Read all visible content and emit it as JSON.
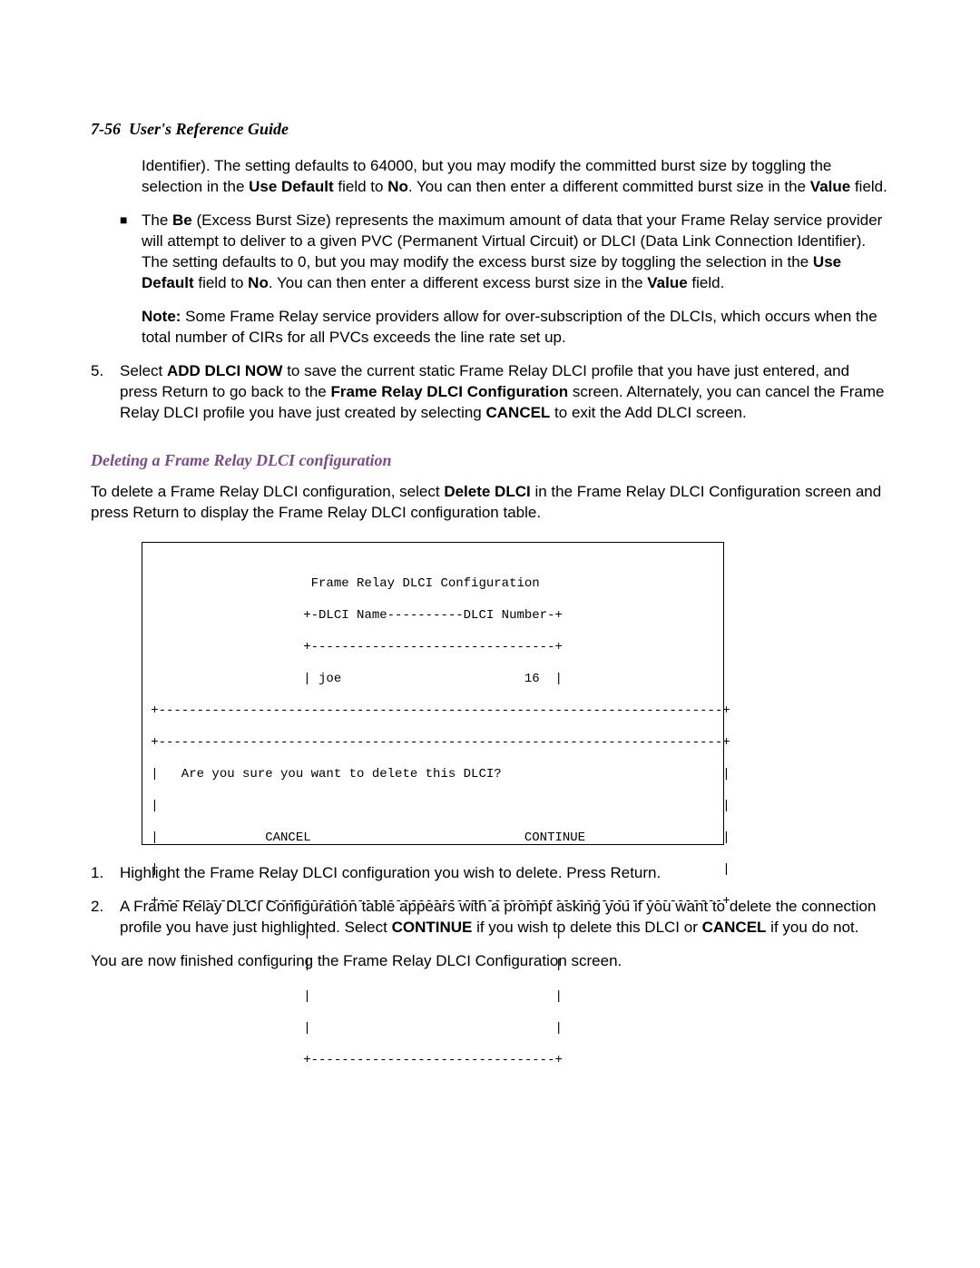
{
  "header": {
    "page_ref": "7-56",
    "title": "User's Reference Guide"
  },
  "para1_a": "Identifier). The setting defaults to 64000, but you may modify the committed burst size by toggling the selection in the ",
  "para1_b1": "Use Default",
  "para1_c": " field to ",
  "para1_b2": "No",
  "para1_d": ". You can then enter a different committed burst size in the ",
  "para1_b3": "Value",
  "para1_e": " field.",
  "bullet_be_a": "The ",
  "bullet_be_b1": "Be",
  "bullet_be_c": " (Excess Burst Size) represents the maximum amount of data that your Frame Relay service provider will attempt to deliver to a given PVC (Permanent Virtual Circuit) or DLCI (Data Link Connection Identifier). The setting defaults to 0, but you may modify the excess burst size by toggling the selection in the ",
  "bullet_be_b2": "Use Default",
  "bullet_be_d": " field to ",
  "bullet_be_b3": "No",
  "bullet_be_e": ". You can then enter a different excess burst size in the ",
  "bullet_be_b4": "Value",
  "bullet_be_f": " field.",
  "note_label": "Note:",
  "note_body": "  Some Frame Relay service providers allow for over-subscription of the DLCIs, which occurs when the total number of CIRs for all PVCs exceeds the line rate set up.",
  "step5_num": "5.",
  "step5_a": "Select ",
  "step5_b1": "ADD DLCI NOW",
  "step5_c": " to save the current static Frame Relay DLCI profile that you have just entered, and press Return to go back to the ",
  "step5_b2": "Frame Relay DLCI Configuration",
  "step5_d": " screen. Alternately, you can cancel the Frame Relay DLCI profile you have just created by selecting ",
  "step5_b3": "CANCEL",
  "step5_e": " to exit the Add DLCI screen.",
  "section_sub": "Deleting a Frame Relay DLCI configuration",
  "delete_intro_a": "To delete a Frame Relay DLCI configuration, select ",
  "delete_intro_b1": "Delete DLCI",
  "delete_intro_c": " in the Frame Relay DLCI Configuration screen and press Return to display the Frame Relay DLCI configuration table.",
  "terminal": {
    "title": "                        Frame Relay DLCI Configuration",
    "head": "                       +-DLCI Name----------DLCI Number-+",
    "sep_top": "                       +--------------------------------+",
    "row": "                       | joe                        16  |",
    "dash1": "   +--------------------------------------------------------------------------+",
    "dash2": "   +--------------------------------------------------------------------------+",
    "q_line": "   |   Are you sure you want to delete this DLCI?                             |",
    "blank_line": "   |                                                                          |",
    "btn_line": "   |              CANCEL                            CONTINUE                  |",
    "blank_line2": "   |                                                                          |",
    "dash3": "   +--------------------------------------------------------------------------+",
    "mid1": "                       |                                |",
    "mid2": "                       |                                |",
    "mid3": "                       |                                |",
    "mid4": "                       |                                |",
    "sep_bot": "                       +--------------------------------+"
  },
  "step1_num": "1.",
  "step1_text": "Highlight the Frame Relay DLCI configuration you wish to delete. Press Return.",
  "step2_num": "2.",
  "step2_a": "A Frame Relay DLCI Configuration table appears with a prompt asking you if you want to delete the connection profile you have just highlighted. Select ",
  "step2_b1": "CONTINUE",
  "step2_c": " if you wish to delete this DLCI or ",
  "step2_b2": "CANCEL",
  "step2_d": " if you do not.",
  "closing": "You are now finished configuring the Frame Relay DLCI Configuration screen."
}
